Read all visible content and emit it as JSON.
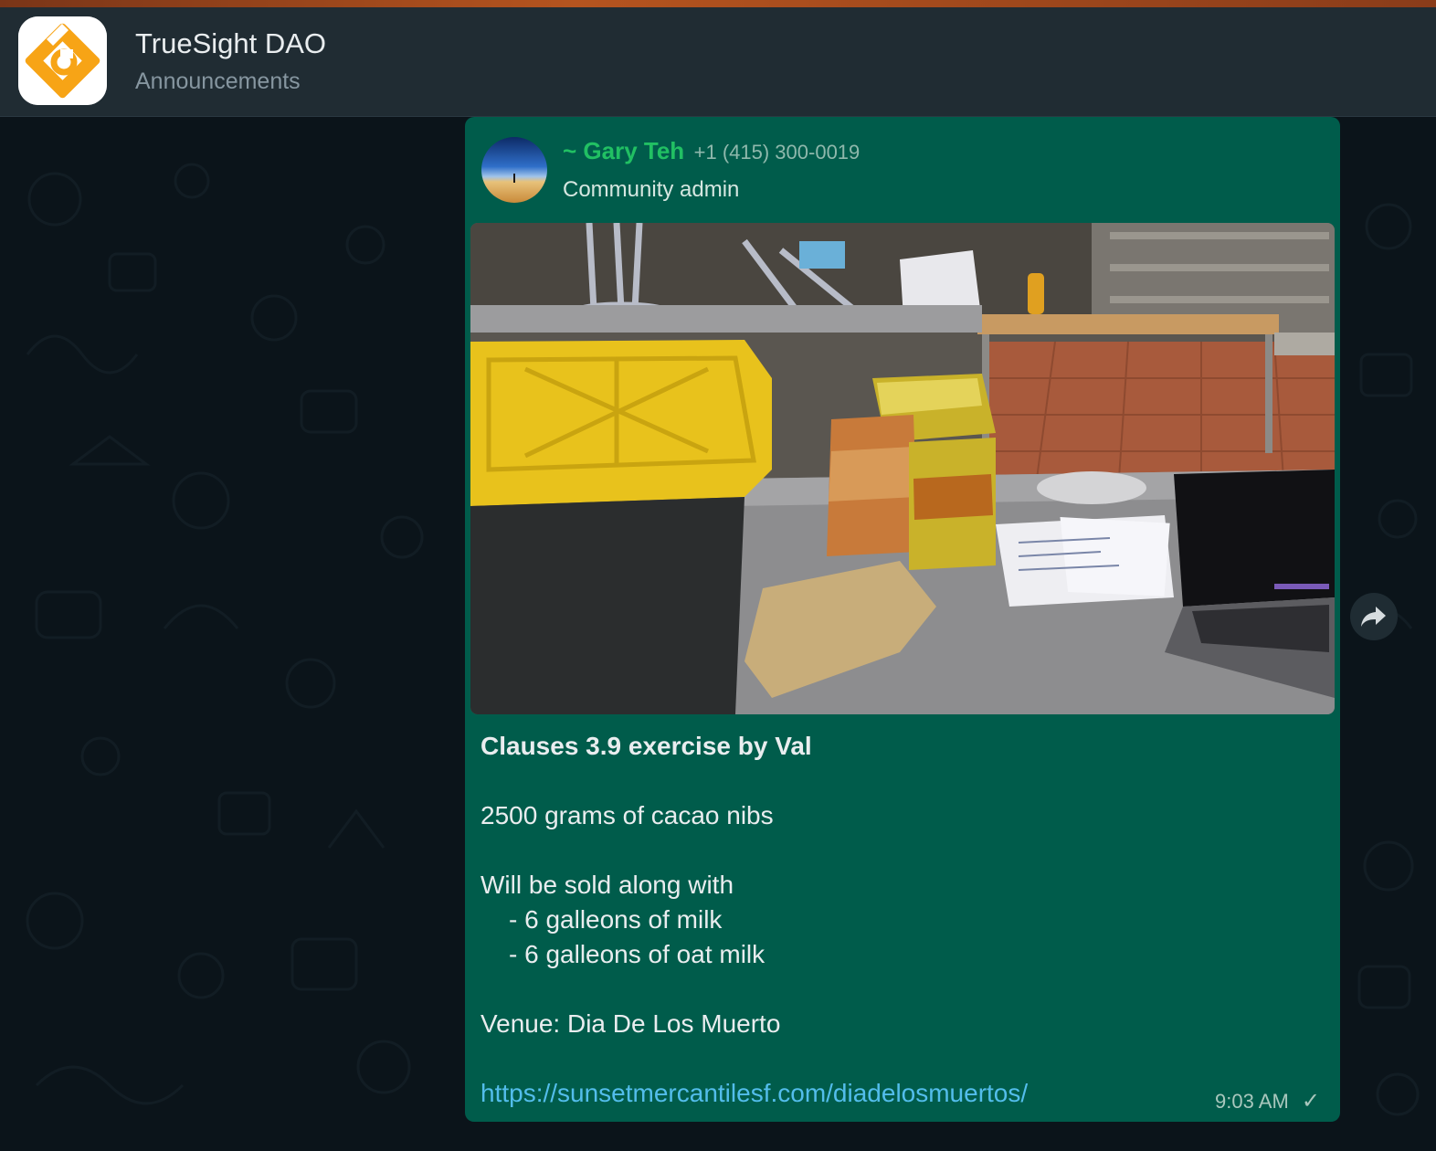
{
  "header": {
    "title": "TrueSight DAO",
    "subtitle": "Announcements",
    "avatar_icon": "truesight-logo-icon"
  },
  "message": {
    "sender_name": "~ Gary Teh",
    "sender_phone": "+1 (415) 300-0019",
    "sender_role": "Community admin",
    "image_icon": "photo-kitchen-cacao-bags",
    "title": "Clauses 3.9 exercise by Val",
    "line_quantity": "2500 grams of cacao nibs",
    "line_sold_intro": "Will be sold along with",
    "line_item_1": "- 6 galleons of milk",
    "line_item_2": "- 6 galleons of oat milk",
    "line_venue": "Venue: Dia De Los Muerto",
    "link": "https://sunsetmercantilesf.com/diadelosmuertos/",
    "time": "9:03 AM",
    "status_icon": "sent-check-icon"
  },
  "colors": {
    "header_bg": "#202c33",
    "chat_bg": "#0b141a",
    "bubble_bg": "#005c4b",
    "sender_name": "#21c063",
    "link": "#53bdeb",
    "logo_orange": "#f7a416"
  }
}
